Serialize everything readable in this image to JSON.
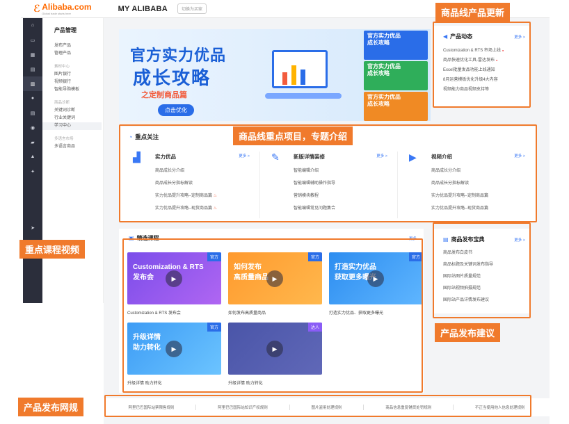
{
  "header": {
    "logo": "Alibaba.com",
    "logo_sub": "Global trade starts here",
    "title": "MY ALIBABA",
    "switch": "切换为买家"
  },
  "nav_icons": [
    "home-icon",
    "card-icon",
    "grid-icon",
    "chat-icon",
    "chart-icon",
    "user-icon",
    "doc-icon",
    "globe-icon",
    "truck-icon",
    "bank-icon",
    "share-icon",
    "send-icon",
    "heart-icon"
  ],
  "side": {
    "title": "产品管理",
    "items": [
      {
        "type": "item",
        "label": "发布产品"
      },
      {
        "type": "item",
        "label": "管理产品"
      },
      {
        "type": "cat",
        "label": "素材中心"
      },
      {
        "type": "item",
        "label": "图片银行"
      },
      {
        "type": "item",
        "label": "视频银行"
      },
      {
        "type": "item",
        "label": "智能导购模板"
      },
      {
        "type": "cat",
        "label": "商品诊断"
      },
      {
        "type": "item",
        "label": "关键词诊断"
      },
      {
        "type": "item",
        "label": "行业关键词"
      },
      {
        "type": "item",
        "label": "学习中心",
        "active": true
      },
      {
        "type": "cat",
        "label": "多语言市场"
      },
      {
        "type": "item",
        "label": "多语言商品"
      }
    ]
  },
  "banner": {
    "line1": "官方实力优品",
    "line2": "成长攻略",
    "line3": "之定制商品篇",
    "button": "点击优化",
    "thumbs": [
      {
        "t": "官方实力优品\n成长攻略",
        "c": "#2a6de8"
      },
      {
        "t": "官方实力优品\n成长攻略",
        "c": "#2fae5a"
      },
      {
        "t": "官方实力优品\n成长攻略",
        "c": "#f08a24"
      }
    ]
  },
  "product_news": {
    "title": "产品动态",
    "more": "更多 >",
    "items": [
      {
        "t": "Customization & RTS 市场上线",
        "dot": true
      },
      {
        "t": "商品快速优化工具-雷达发布",
        "dot": true
      },
      {
        "t": "Excel批量发品功能上线通知",
        "dot": false
      },
      {
        "t": "8月运营模板优化升级4大内容",
        "dot": false
      },
      {
        "t": "视频能力商品视频支持等",
        "dot": false
      }
    ]
  },
  "focus": {
    "title": "重点关注",
    "cols": [
      {
        "title": "实力优品",
        "more": "更多 >",
        "icon": "growth-icon",
        "rows": [
          {
            "t": "商品成长分介绍"
          },
          {
            "t": "商品成长分指标解读"
          },
          {
            "t": "实力优品提升攻略--定制商品篇",
            "fire": true
          },
          {
            "t": "实力优品提升攻略--现货商品篇",
            "fire": true
          }
        ]
      },
      {
        "title": "新版详情装修",
        "more": "更多 >",
        "icon": "pen-icon",
        "rows": [
          {
            "t": "智能编辑介绍"
          },
          {
            "t": "智能编辑辅助操作指导"
          },
          {
            "t": "营销模块教程"
          },
          {
            "t": "智能编辑常见问题集合"
          }
        ]
      },
      {
        "title": "视频介绍",
        "more": "更多 >",
        "icon": "video-icon",
        "rows": [
          {
            "t": "商品成长分介绍"
          },
          {
            "t": "商品成长分指标解读"
          },
          {
            "t": "实力优品提升攻略--定制商品篇"
          },
          {
            "t": "实力优品提升攻略--现货商品篇"
          }
        ]
      }
    ]
  },
  "courses": {
    "title": "精选课程",
    "more": "更多",
    "cards": [
      {
        "title": "Customization & RTS\n发布会",
        "tag": "官方",
        "caption": "Customization & RTS 发布会",
        "bg": "linear-gradient(135deg,#7b4dea,#b066f2)"
      },
      {
        "title": "如何发布\n高质量商品",
        "tag": "官方",
        "caption": "如何发布高质量商品",
        "bg": "linear-gradient(135deg,#ff9a2e,#ffb84d)"
      },
      {
        "title": "打造实力优品\n获取更多曝光",
        "tag": "官方",
        "caption": "打造实力优品、获取更多曝光",
        "bg": "linear-gradient(135deg,#2d8df0,#5fb6ff)"
      },
      {
        "title": "升级详情\n助力转化",
        "tag": "官方",
        "caption": "升级详情 助力转化",
        "bg": "linear-gradient(135deg,#3d9cf5,#6cc4ff)"
      },
      {
        "title": "",
        "tag": "达人",
        "caption": "升级详情 助力转化",
        "bg": "linear-gradient(135deg,#4a55a8,#6068b8)"
      }
    ]
  },
  "guide": {
    "title": "商品发布宝典",
    "more": "更多 >",
    "items": [
      "商品发布白皮书",
      "商品标题及关键词发布指导",
      "国际站图片质量规范",
      "国际站视频拍摄规范",
      "国际站产品详情发布建议"
    ]
  },
  "rules": [
    "阿里巴巴国际站禁限售规则",
    "阿里巴巴国际站知识产权规则",
    "图片盗用处理规则",
    "商品信息重复铺货处罚规则",
    "不正当使用他人信息处理规则"
  ],
  "callouts": {
    "news": "商品线产品更新",
    "focus": "商品线重点项目，专题介绍",
    "courses": "重点课程视频",
    "guide": "产品发布建议",
    "rules": "产品发布网规"
  },
  "colors": {
    "accent": "#f07a2c",
    "primary": "#2a6de8",
    "sidebar": "#2b2e3b"
  }
}
